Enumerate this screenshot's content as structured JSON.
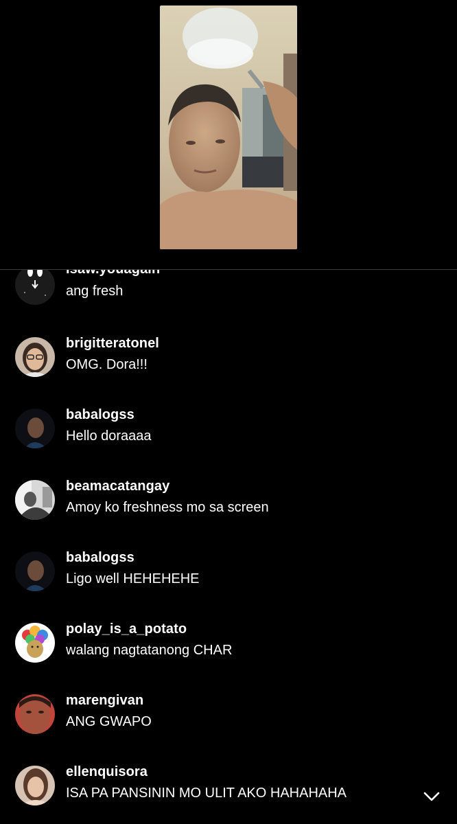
{
  "live_video": {
    "icon": "video-frame"
  },
  "comments": [
    {
      "username": "isaw.youagain",
      "text": "ang fresh"
    },
    {
      "username": "brigitteratonel",
      "text": "OMG. Dora!!!"
    },
    {
      "username": "babalogss",
      "text": "Hello doraaaa"
    },
    {
      "username": "beamacatangay",
      "text": "Amoy ko freshness mo sa screen"
    },
    {
      "username": "babalogss",
      "text": "Ligo well HEHEHEHE"
    },
    {
      "username": "polay_is_a_potato",
      "text": "walang nagtatanong CHAR"
    },
    {
      "username": "marengivan",
      "text": "ANG GWAPO"
    },
    {
      "username": "ellenquisora",
      "text": "ISA PA PANSININ MO ULIT AKO HAHAHAHA"
    }
  ],
  "controls": {
    "scroll_icon": "chevron-down-icon"
  }
}
